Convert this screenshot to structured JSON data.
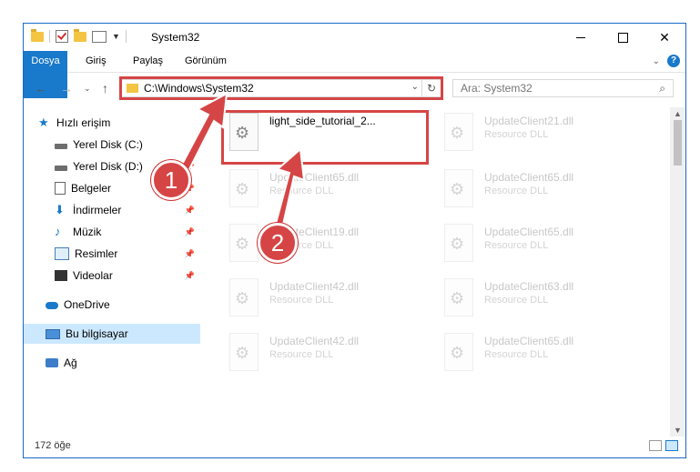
{
  "window": {
    "title": "System32",
    "buttons": {
      "minimize": "",
      "maximize": "",
      "close": "✕"
    }
  },
  "ribbon": {
    "tabs": [
      "Dosya",
      "Giriş",
      "Paylaş",
      "Görünüm"
    ]
  },
  "address": {
    "path": "C:\\Windows\\System32",
    "search_placeholder": "Ara: System32"
  },
  "sidebar": {
    "items": [
      {
        "label": "Hızlı erişim",
        "icon": "star-icon"
      },
      {
        "label": "Yerel Disk (C:)",
        "icon": "drive-icon"
      },
      {
        "label": "Yerel Disk (D:)",
        "icon": "drive-icon",
        "pinned": true
      },
      {
        "label": "Belgeler",
        "icon": "document-icon",
        "pinned": true
      },
      {
        "label": "İndirmeler",
        "icon": "download-icon",
        "pinned": true
      },
      {
        "label": "Müzik",
        "icon": "music-icon",
        "pinned": true
      },
      {
        "label": "Resimler",
        "icon": "pictures-icon",
        "pinned": true
      },
      {
        "label": "Videolar",
        "icon": "video-icon",
        "pinned": true
      },
      {
        "label": "OneDrive",
        "icon": "cloud-icon"
      },
      {
        "label": "Bu bilgisayar",
        "icon": "computer-icon",
        "selected": true
      },
      {
        "label": "Ağ",
        "icon": "network-icon"
      }
    ]
  },
  "files": [
    {
      "name": "light_side_tutorial_2...",
      "desc": ""
    },
    {
      "name": "UpdateClient21.dll",
      "desc": "Resource DLL"
    },
    {
      "name": "UpdateClient65.dll",
      "desc": "Resource DLL"
    },
    {
      "name": "UpdateClient65.dll",
      "desc": "Resource DLL"
    },
    {
      "name": "UpdateClient19.dll",
      "desc": "Resource DLL"
    },
    {
      "name": "UpdateClient65.dll",
      "desc": "Resource DLL"
    },
    {
      "name": "UpdateClient42.dll",
      "desc": "Resource DLL"
    },
    {
      "name": "UpdateClient63.dll",
      "desc": "Resource DLL"
    },
    {
      "name": "UpdateClient42.dll",
      "desc": "Resource DLL"
    },
    {
      "name": "UpdateClient65.dll",
      "desc": "Resource DLL"
    }
  ],
  "status": {
    "count": "172 öğe"
  },
  "annotations": {
    "step1": "1",
    "step2": "2"
  },
  "colors": {
    "accent": "#1979ca",
    "annotation": "#d64545"
  }
}
